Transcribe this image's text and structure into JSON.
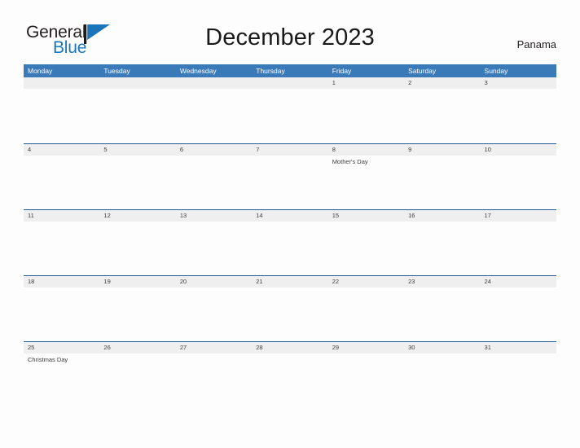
{
  "brand": {
    "name_part1": "General",
    "name_part2": "Blue",
    "mark": "blue-flag-triangle",
    "accent_color": "#1b75bb"
  },
  "header": {
    "title": "December 2023",
    "country": "Panama"
  },
  "colors": {
    "header_blue": "#3a7ab8",
    "band_gray": "#efefef",
    "band_border": "#1f5b93",
    "text_dark": "#3c3c3c",
    "page_background": "#fdfdfd"
  },
  "calendar": {
    "weekdays": [
      "Monday",
      "Tuesday",
      "Wednesday",
      "Thursday",
      "Friday",
      "Saturday",
      "Sunday"
    ],
    "weeks": [
      {
        "days": [
          {
            "date": "",
            "event": ""
          },
          {
            "date": "",
            "event": ""
          },
          {
            "date": "",
            "event": ""
          },
          {
            "date": "",
            "event": ""
          },
          {
            "date": "1",
            "event": ""
          },
          {
            "date": "2",
            "event": ""
          },
          {
            "date": "3",
            "event": ""
          }
        ]
      },
      {
        "days": [
          {
            "date": "4",
            "event": ""
          },
          {
            "date": "5",
            "event": ""
          },
          {
            "date": "6",
            "event": ""
          },
          {
            "date": "7",
            "event": ""
          },
          {
            "date": "8",
            "event": "Mother's Day"
          },
          {
            "date": "9",
            "event": ""
          },
          {
            "date": "10",
            "event": ""
          }
        ]
      },
      {
        "days": [
          {
            "date": "11",
            "event": ""
          },
          {
            "date": "12",
            "event": ""
          },
          {
            "date": "13",
            "event": ""
          },
          {
            "date": "14",
            "event": ""
          },
          {
            "date": "15",
            "event": ""
          },
          {
            "date": "16",
            "event": ""
          },
          {
            "date": "17",
            "event": ""
          }
        ]
      },
      {
        "days": [
          {
            "date": "18",
            "event": ""
          },
          {
            "date": "19",
            "event": ""
          },
          {
            "date": "20",
            "event": ""
          },
          {
            "date": "21",
            "event": ""
          },
          {
            "date": "22",
            "event": ""
          },
          {
            "date": "23",
            "event": ""
          },
          {
            "date": "24",
            "event": ""
          }
        ]
      },
      {
        "days": [
          {
            "date": "25",
            "event": "Christmas Day"
          },
          {
            "date": "26",
            "event": ""
          },
          {
            "date": "27",
            "event": ""
          },
          {
            "date": "28",
            "event": ""
          },
          {
            "date": "29",
            "event": ""
          },
          {
            "date": "30",
            "event": ""
          },
          {
            "date": "31",
            "event": ""
          }
        ]
      }
    ]
  }
}
